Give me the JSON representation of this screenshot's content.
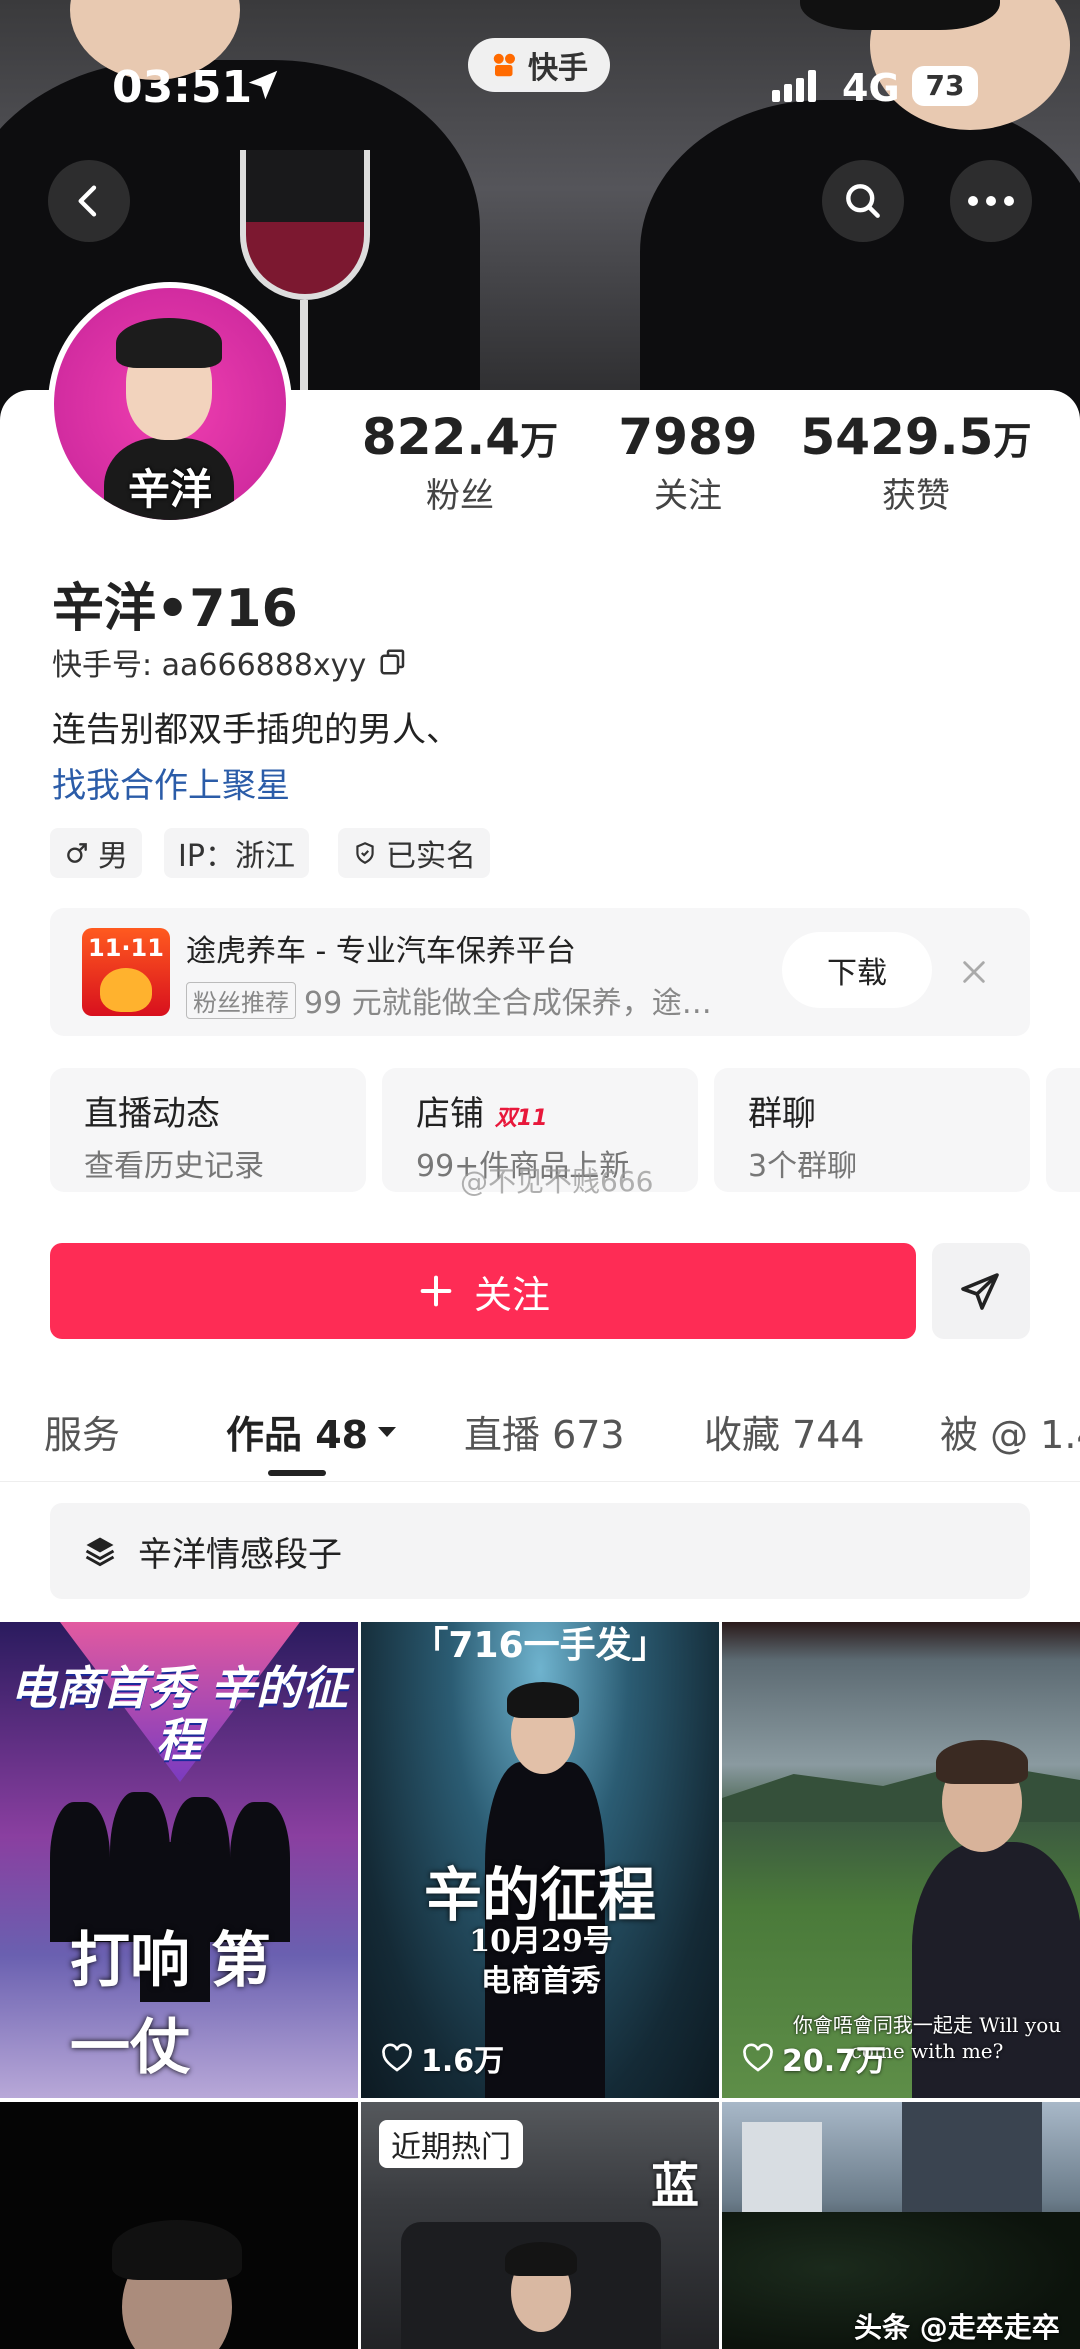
{
  "status_bar": {
    "time": "03:51",
    "network": "4G",
    "battery": "73"
  },
  "app_pill": {
    "label": "快手"
  },
  "profile": {
    "avatar_name": "辛洋",
    "stats": [
      {
        "value": "822.4",
        "unit": "万",
        "label": "粉丝"
      },
      {
        "value": "7989",
        "unit": "",
        "label": "关注"
      },
      {
        "value": "5429.5",
        "unit": "万",
        "label": "获赞"
      }
    ],
    "name": "辛洋•716",
    "id_line": "快手号: aa666888xyy",
    "bio": "连告别都双手插兜的男人、",
    "link": "找我合作上聚星",
    "tags": [
      "男",
      "IP：浙江",
      "已实名"
    ]
  },
  "ad": {
    "badge": "11·11",
    "title": "途虎养车 - 专业汽车保养平台",
    "label": "粉丝推荐",
    "desc": "99 元就能做全合成保养，途…",
    "button": "下载"
  },
  "tiles": [
    {
      "title": "直播动态",
      "sub": "查看历史记录"
    },
    {
      "title": "店铺",
      "badge": "双11",
      "sub": "99+件商品上新"
    },
    {
      "title": "群聊",
      "sub": "3个群聊"
    }
  ],
  "watermark": "@不见不贱666",
  "follow_button": "关注",
  "tabs": [
    {
      "label": "服务"
    },
    {
      "label": "作品 48"
    },
    {
      "label": "直播 673"
    },
    {
      "label": "收藏 744"
    },
    {
      "label": "被 @ 1.4"
    }
  ],
  "collection": {
    "label": "辛洋情感段子"
  },
  "videos": [
    {
      "overlay": "电商首秀 辛的征程",
      "caption": "打响 第一仗",
      "likes": ""
    },
    {
      "overlay": "辛的征程",
      "caption": "10月29号 电商首秀",
      "top": "「716一手发」",
      "likes": "1.6万"
    },
    {
      "overlay": "",
      "caption": "你會唔會同我一起走 Will you come with me?",
      "likes": "20.7万"
    },
    {
      "overlay": "",
      "caption": "",
      "likes": ""
    },
    {
      "overlay": "蓝",
      "caption": "",
      "badge": "近期热门",
      "likes": ""
    },
    {
      "overlay": "",
      "caption": "",
      "likes": ""
    }
  ],
  "corner_watermark": "头条 @走卒走卒"
}
